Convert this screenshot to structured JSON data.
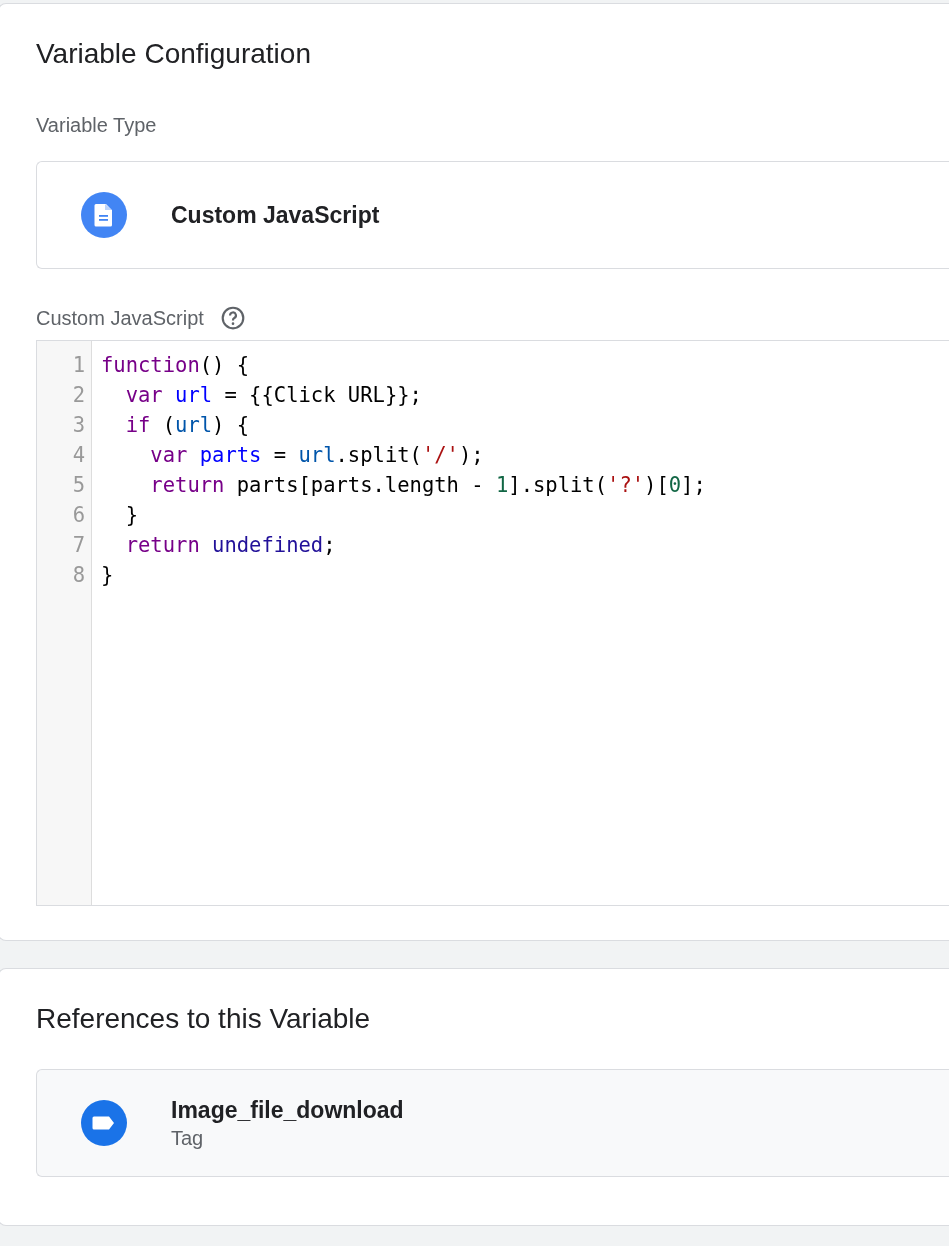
{
  "configuration": {
    "title": "Variable Configuration",
    "type_label": "Variable Type",
    "type_name": "Custom JavaScript",
    "code_label": "Custom JavaScript",
    "code_lines": [
      {
        "number": "1",
        "tokens": [
          {
            "text": "function",
            "kind": "keyword"
          },
          {
            "text": "() {",
            "kind": "plain"
          }
        ]
      },
      {
        "number": "2",
        "tokens": [
          {
            "text": "  var",
            "kind": "keyword"
          },
          {
            "text": " url",
            "kind": "def"
          },
          {
            "text": " = {{Click URL}};",
            "kind": "plain"
          }
        ]
      },
      {
        "number": "3",
        "tokens": [
          {
            "text": "  if",
            "kind": "keyword"
          },
          {
            "text": " (",
            "kind": "plain"
          },
          {
            "text": "url",
            "kind": "variable"
          },
          {
            "text": ") {",
            "kind": "plain"
          }
        ]
      },
      {
        "number": "4",
        "tokens": [
          {
            "text": "    var",
            "kind": "keyword"
          },
          {
            "text": " parts",
            "kind": "def"
          },
          {
            "text": " = ",
            "kind": "plain"
          },
          {
            "text": "url",
            "kind": "variable"
          },
          {
            "text": ".split(",
            "kind": "plain"
          },
          {
            "text": "'/'",
            "kind": "string"
          },
          {
            "text": ");",
            "kind": "plain"
          }
        ]
      },
      {
        "number": "5",
        "tokens": [
          {
            "text": "    return",
            "kind": "keyword"
          },
          {
            "text": " parts[parts.length - ",
            "kind": "plain"
          },
          {
            "text": "1",
            "kind": "number"
          },
          {
            "text": "].split(",
            "kind": "plain"
          },
          {
            "text": "'?'",
            "kind": "string"
          },
          {
            "text": ")[",
            "kind": "plain"
          },
          {
            "text": "0",
            "kind": "number"
          },
          {
            "text": "];",
            "kind": "plain"
          }
        ]
      },
      {
        "number": "6",
        "tokens": [
          {
            "text": "  }",
            "kind": "plain"
          }
        ]
      },
      {
        "number": "7",
        "tokens": [
          {
            "text": "  return",
            "kind": "keyword"
          },
          {
            "text": " undefined",
            "kind": "atom"
          },
          {
            "text": ";",
            "kind": "plain"
          }
        ]
      },
      {
        "number": "8",
        "tokens": [
          {
            "text": "}",
            "kind": "plain"
          }
        ]
      }
    ]
  },
  "references": {
    "title": "References to this Variable",
    "items": [
      {
        "name": "Image_file_download",
        "type": "Tag"
      }
    ]
  }
}
